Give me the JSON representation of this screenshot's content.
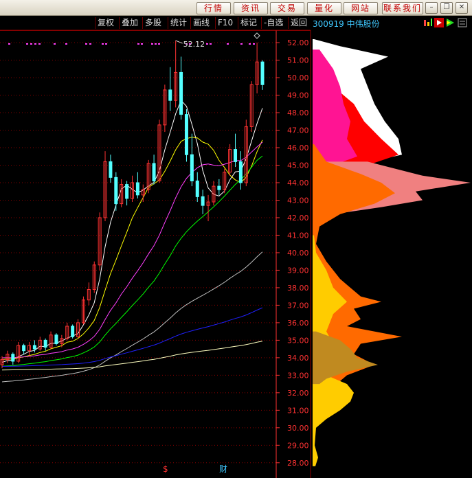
{
  "top_buttons": [
    "行情",
    "资讯",
    "交易",
    "量化",
    "网站",
    "联系我们"
  ],
  "window_icons": [
    "minimize-icon",
    "restore-icon",
    "close-icon"
  ],
  "toolbar": [
    "复权",
    "叠加",
    "多股",
    "统计",
    "画线",
    "F10",
    "标记",
    "-自选",
    "返回"
  ],
  "stock": {
    "code": "300919",
    "name": "中伟股份"
  },
  "colors": {
    "up": "#ff3232",
    "down": "#54ffff",
    "grid": "#8b0000",
    "axis": "#ff3232",
    "ma5": "#ffffff",
    "ma10": "#ffff00",
    "ma20": "#ff40ff",
    "ma30": "#00ff00",
    "ma60": "#c0c0c0",
    "ma120": "#2020ff",
    "ma250": "#ffffc0"
  },
  "chart_data": {
    "type": "candlestick",
    "y_ticks": [
      "52.00",
      "51.00",
      "50.00",
      "49.00",
      "48.00",
      "47.00",
      "46.00",
      "45.00",
      "44.00",
      "43.00",
      "42.00",
      "41.00",
      "40.00",
      "39.00",
      "38.00",
      "37.00",
      "36.00",
      "35.00",
      "34.00",
      "33.00",
      "32.00",
      "31.00",
      "30.00",
      "29.00",
      "28.00"
    ],
    "ylim": [
      27.6,
      52.2
    ],
    "annotation": "52.12",
    "bottom_markers": [
      "$",
      "财"
    ],
    "ohlc": [
      [
        33.6,
        34.1,
        33.4,
        33.9
      ],
      [
        33.9,
        34.4,
        33.7,
        34.2
      ],
      [
        34.2,
        34.3,
        33.6,
        33.8
      ],
      [
        33.8,
        34.9,
        33.7,
        34.7
      ],
      [
        34.7,
        34.8,
        34.2,
        34.4
      ],
      [
        34.4,
        34.9,
        34.1,
        34.7
      ],
      [
        34.7,
        35.0,
        34.3,
        34.5
      ],
      [
        34.5,
        35.2,
        34.4,
        35.0
      ],
      [
        35.0,
        35.1,
        34.4,
        34.6
      ],
      [
        34.6,
        35.5,
        34.5,
        35.3
      ],
      [
        35.3,
        35.4,
        34.7,
        34.8
      ],
      [
        34.8,
        35.3,
        34.6,
        35.1
      ],
      [
        35.1,
        36.0,
        35.0,
        35.8
      ],
      [
        35.8,
        35.9,
        35.1,
        35.2
      ],
      [
        35.2,
        36.2,
        35.1,
        36.0
      ],
      [
        36.0,
        37.5,
        35.9,
        37.3
      ],
      [
        37.3,
        38.3,
        37.0,
        37.9
      ],
      [
        37.9,
        39.5,
        37.7,
        39.3
      ],
      [
        39.3,
        42.3,
        39.0,
        42.0
      ],
      [
        42.0,
        45.8,
        41.8,
        45.2
      ],
      [
        45.2,
        45.6,
        44.0,
        44.3
      ],
      [
        44.3,
        44.6,
        42.4,
        42.8
      ],
      [
        42.8,
        44.2,
        42.6,
        43.9
      ],
      [
        43.9,
        44.1,
        42.7,
        43.1
      ],
      [
        43.1,
        44.4,
        42.9,
        44.0
      ],
      [
        44.0,
        44.6,
        43.1,
        43.3
      ],
      [
        43.3,
        43.9,
        42.9,
        43.6
      ],
      [
        43.6,
        45.3,
        43.4,
        45.1
      ],
      [
        45.1,
        45.6,
        43.9,
        44.1
      ],
      [
        44.1,
        47.6,
        44.0,
        47.3
      ],
      [
        47.3,
        49.6,
        46.9,
        49.3
      ],
      [
        49.3,
        50.6,
        48.1,
        48.7
      ],
      [
        48.7,
        52.12,
        48.3,
        50.3
      ],
      [
        50.3,
        51.2,
        47.6,
        47.9
      ],
      [
        47.9,
        48.2,
        45.2,
        45.6
      ],
      [
        45.6,
        46.8,
        43.8,
        44.1
      ],
      [
        44.1,
        44.6,
        42.9,
        43.2
      ],
      [
        43.2,
        43.6,
        42.2,
        42.7
      ],
      [
        42.7,
        43.3,
        41.8,
        42.9
      ],
      [
        42.9,
        44.1,
        42.7,
        43.8
      ],
      [
        43.8,
        44.2,
        43.3,
        43.6
      ],
      [
        43.6,
        44.8,
        43.4,
        44.6
      ],
      [
        44.6,
        46.2,
        44.4,
        45.9
      ],
      [
        45.9,
        46.8,
        44.9,
        45.2
      ],
      [
        45.2,
        45.8,
        43.6,
        44.0
      ],
      [
        44.0,
        47.6,
        43.8,
        47.2
      ],
      [
        47.2,
        49.8,
        46.9,
        49.6
      ],
      [
        49.6,
        52.0,
        49.1,
        50.9
      ],
      [
        50.9,
        51.0,
        49.3,
        49.6
      ]
    ],
    "ma_series": [
      {
        "key": "ma5",
        "start": [
          0,
          33.7
        ]
      },
      {
        "key": "ma10",
        "start": [
          0,
          33.9
        ]
      },
      {
        "key": "ma20",
        "start": [
          0,
          34.0
        ]
      },
      {
        "key": "ma30",
        "start": [
          0,
          33.5
        ]
      },
      {
        "key": "ma60",
        "start": [
          0,
          32.6
        ]
      },
      {
        "key": "ma120",
        "start": [
          0,
          33.5
        ]
      },
      {
        "key": "ma250",
        "start": [
          0,
          33.3
        ]
      }
    ]
  }
}
